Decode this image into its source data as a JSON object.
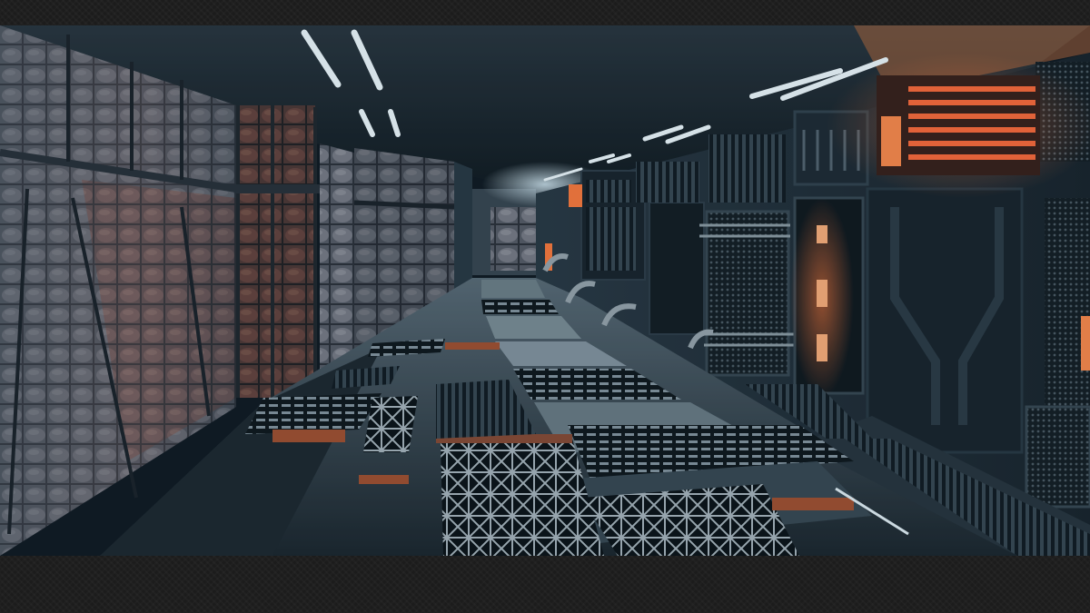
{
  "scene": {
    "subject": "sci-fi-corridor",
    "colors": {
      "steel": "#1d2730",
      "steel_dark": "#0e151b",
      "padding": "#5a5a62",
      "padding_warm": "#8a4a3c",
      "ceiling": "#222b33",
      "floor": "#3c4a55",
      "light_cool": "#f2fbff",
      "light_warm": "#ff6a3a",
      "orange_glow": "#ff7a3c"
    }
  }
}
